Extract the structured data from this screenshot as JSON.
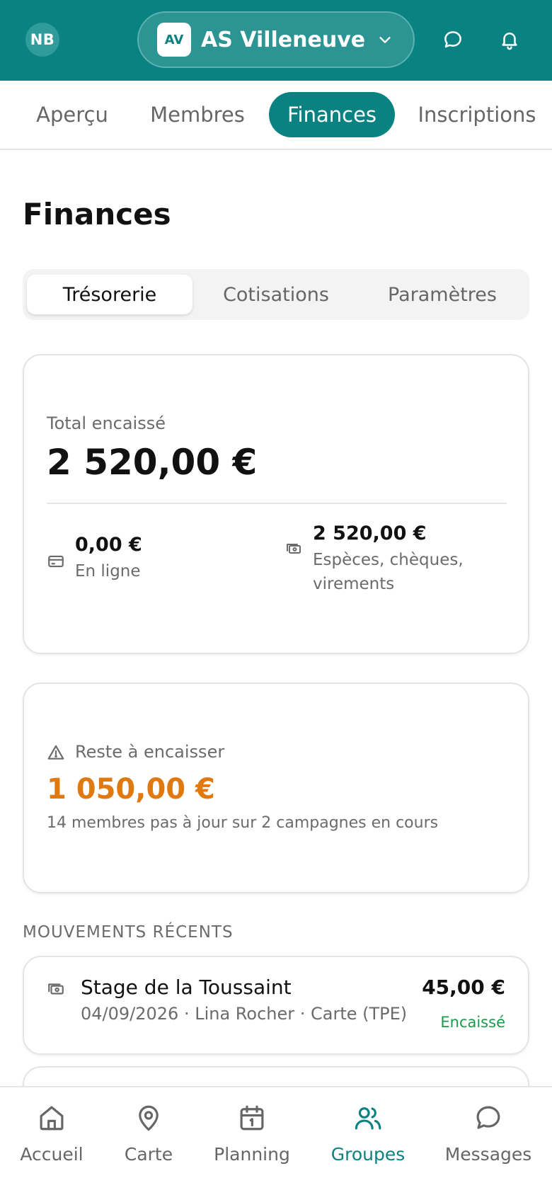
{
  "header": {
    "avatar_initials": "NB",
    "club_badge": "AV",
    "club_name": "AS Villeneuve",
    "icons": [
      "chevron-down-icon",
      "chat-icon",
      "bell-icon"
    ],
    "brand_color": "#0a8282"
  },
  "top_tabs": [
    {
      "label": "Aperçu",
      "active": false
    },
    {
      "label": "Membres",
      "active": false
    },
    {
      "label": "Finances",
      "active": true
    },
    {
      "label": "Inscriptions",
      "active": false
    }
  ],
  "page_title": "Finances",
  "segments": [
    {
      "label": "Trésorerie",
      "active": true
    },
    {
      "label": "Cotisations",
      "active": false
    },
    {
      "label": "Paramètres",
      "active": false
    }
  ],
  "total_card": {
    "label": "Total encaissé",
    "amount": "2 520,00 €",
    "online_amount": "0,00 €",
    "online_label": "En ligne",
    "offline_amount": "2 520,00 €",
    "offline_label": "Espèces, chèques, virements"
  },
  "remain_card": {
    "label": "Reste à encaisser",
    "amount": "1 050,00 €",
    "detail": "14 membres pas à jour sur 2 campagnes en cours",
    "accent_color": "#e07a10"
  },
  "recent": {
    "section_title": "MOUVEMENTS RÉCENTS",
    "items": [
      {
        "title": "Stage de la Toussaint",
        "meta": "04/09/2026 · Lina Rocher · Carte (TPE)",
        "amount": "45,00 €",
        "status": "Encaissé",
        "status_color": "#1a9b4b"
      }
    ]
  },
  "bottom_nav": [
    {
      "label": "Accueil",
      "icon": "home-icon",
      "active": false
    },
    {
      "label": "Carte",
      "icon": "map-pin-icon",
      "active": false
    },
    {
      "label": "Planning",
      "icon": "calendar-icon",
      "active": false
    },
    {
      "label": "Groupes",
      "icon": "users-icon",
      "active": true
    },
    {
      "label": "Messages",
      "icon": "chat-icon",
      "active": false
    }
  ]
}
